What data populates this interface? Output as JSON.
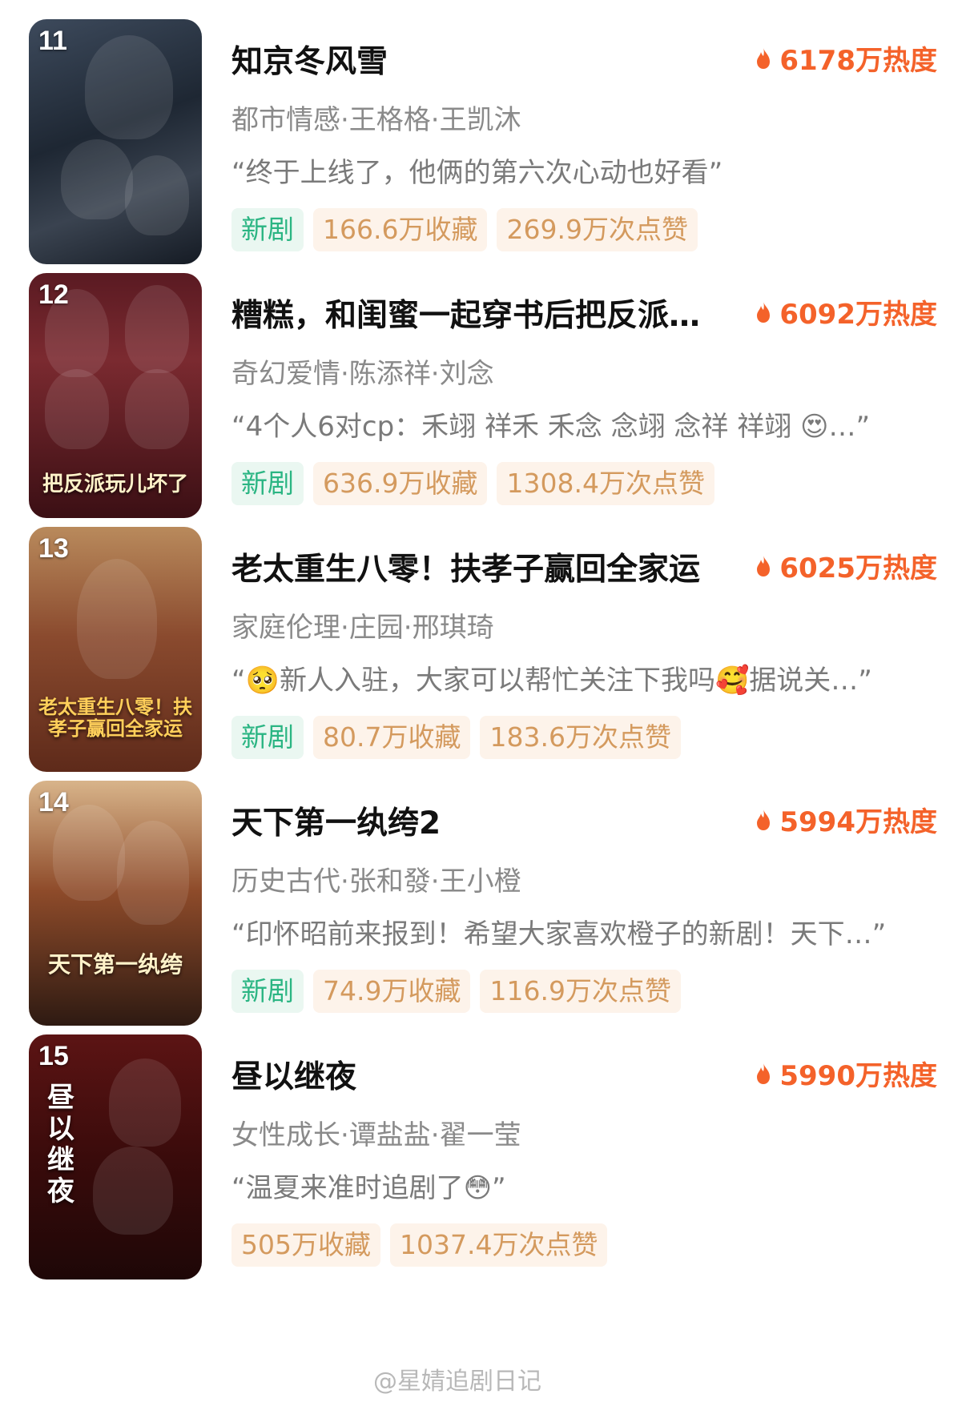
{
  "accent_color": "#f4622a",
  "items": [
    {
      "rank": "11",
      "poster_text": "知京冬风雪",
      "title": "知京冬风雪",
      "heat": "6178万热度",
      "meta": "都市情感·王格格·王凯沐",
      "quote": "“终于上线了，他俩的第六次心动也好看”",
      "tags": [
        "新剧",
        "166.6万收藏",
        "269.9万次点赞"
      ]
    },
    {
      "rank": "12",
      "poster_text": "把反派玩儿坏了",
      "title": "糟糕，和闺蜜一起穿书后把反派…",
      "heat": "6092万热度",
      "meta": "奇幻爱情·陈添祥·刘念",
      "quote": "“4个人6对cp：禾翊 祥禾 禾念 念翊 念祥 祥翊 😍…”",
      "tags": [
        "新剧",
        "636.9万收藏",
        "1308.4万次点赞"
      ]
    },
    {
      "rank": "13",
      "poster_text": "老太重生八零！扶孝子赢回全家运",
      "title": "老太重生八零！扶孝子赢回全家运",
      "heat": "6025万热度",
      "meta": "家庭伦理·庄园·邢琪琦",
      "quote": "“🥺新人入驻，大家可以帮忙关注下我吗🥰据说关…”",
      "tags": [
        "新剧",
        "80.7万收藏",
        "183.6万次点赞"
      ]
    },
    {
      "rank": "14",
      "poster_text": "天下第一纨绔",
      "title": "天下第一纨绔2",
      "heat": "5994万热度",
      "meta": "历史古代·张和發·王小橙",
      "quote": "“印怀昭前来报到！希望大家喜欢橙子的新剧！天下…”",
      "tags": [
        "新剧",
        "74.9万收藏",
        "116.9万次点赞"
      ]
    },
    {
      "rank": "15",
      "poster_text": "昼以继夜",
      "title": "昼以继夜",
      "heat": "5990万热度",
      "meta": "女性成长·谭盐盐·翟一莹",
      "quote": "“温夏来准时追剧了😳”",
      "tags": [
        "505万收藏",
        "1037.4万次点赞"
      ]
    }
  ],
  "watermark": "@星婧追剧日记"
}
